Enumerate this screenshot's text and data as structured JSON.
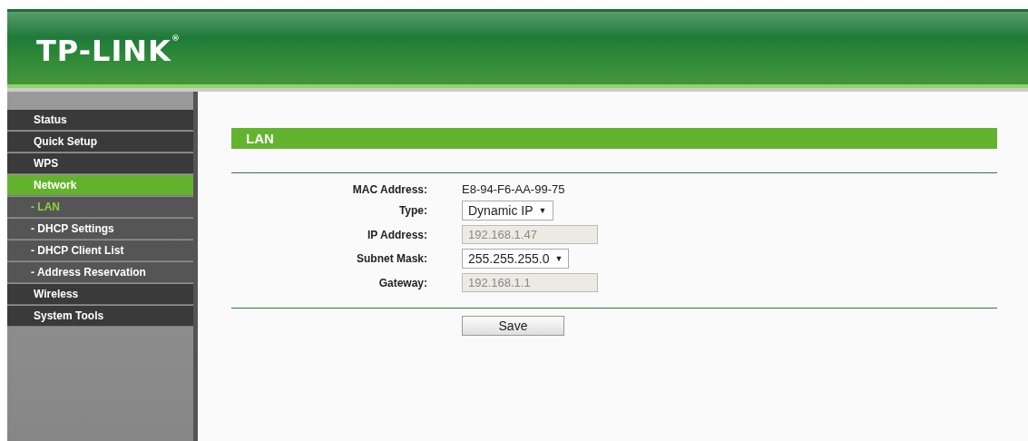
{
  "header": {
    "logo": "TP-LINK$^{®}$"
  },
  "sidebar": {
    "items": [
      {
        "label": "Status",
        "kind": "main",
        "selected": false
      },
      {
        "label": "Quick Setup",
        "kind": "main",
        "selected": false
      },
      {
        "label": "WPS",
        "kind": "main",
        "selected": false
      },
      {
        "label": "Network",
        "kind": "main",
        "selected": true
      },
      {
        "label": "- LAN",
        "kind": "sub",
        "selected": true
      },
      {
        "label": "- DHCP Settings",
        "kind": "sub",
        "selected": false
      },
      {
        "label": "- DHCP Client List",
        "kind": "sub",
        "selected": false
      },
      {
        "label": "- Address Reservation",
        "kind": "sub",
        "selected": false
      },
      {
        "label": "Wireless",
        "kind": "main",
        "selected": false
      },
      {
        "label": "System Tools",
        "kind": "main",
        "selected": false
      }
    ]
  },
  "section": {
    "title": "LAN"
  },
  "fields": [
    {
      "label": "MAC Address:",
      "kind": "text",
      "value": "E8-94-F6-AA-99-75"
    },
    {
      "label": "Type:",
      "kind": "select",
      "value": "Dynamic IP",
      "caret": "▼"
    },
    {
      "label": "IP Address:",
      "kind": "input",
      "value": "192.168.1.47",
      "disabled": true
    },
    {
      "label": "Subnet Mask:",
      "kind": "select",
      "value": "255.255.255.0",
      "caret": "▼"
    },
    {
      "label": "Gateway:",
      "kind": "input",
      "value": "192.168.1.1",
      "disabled": true
    }
  ],
  "buttons": [
    "Save"
  ]
}
